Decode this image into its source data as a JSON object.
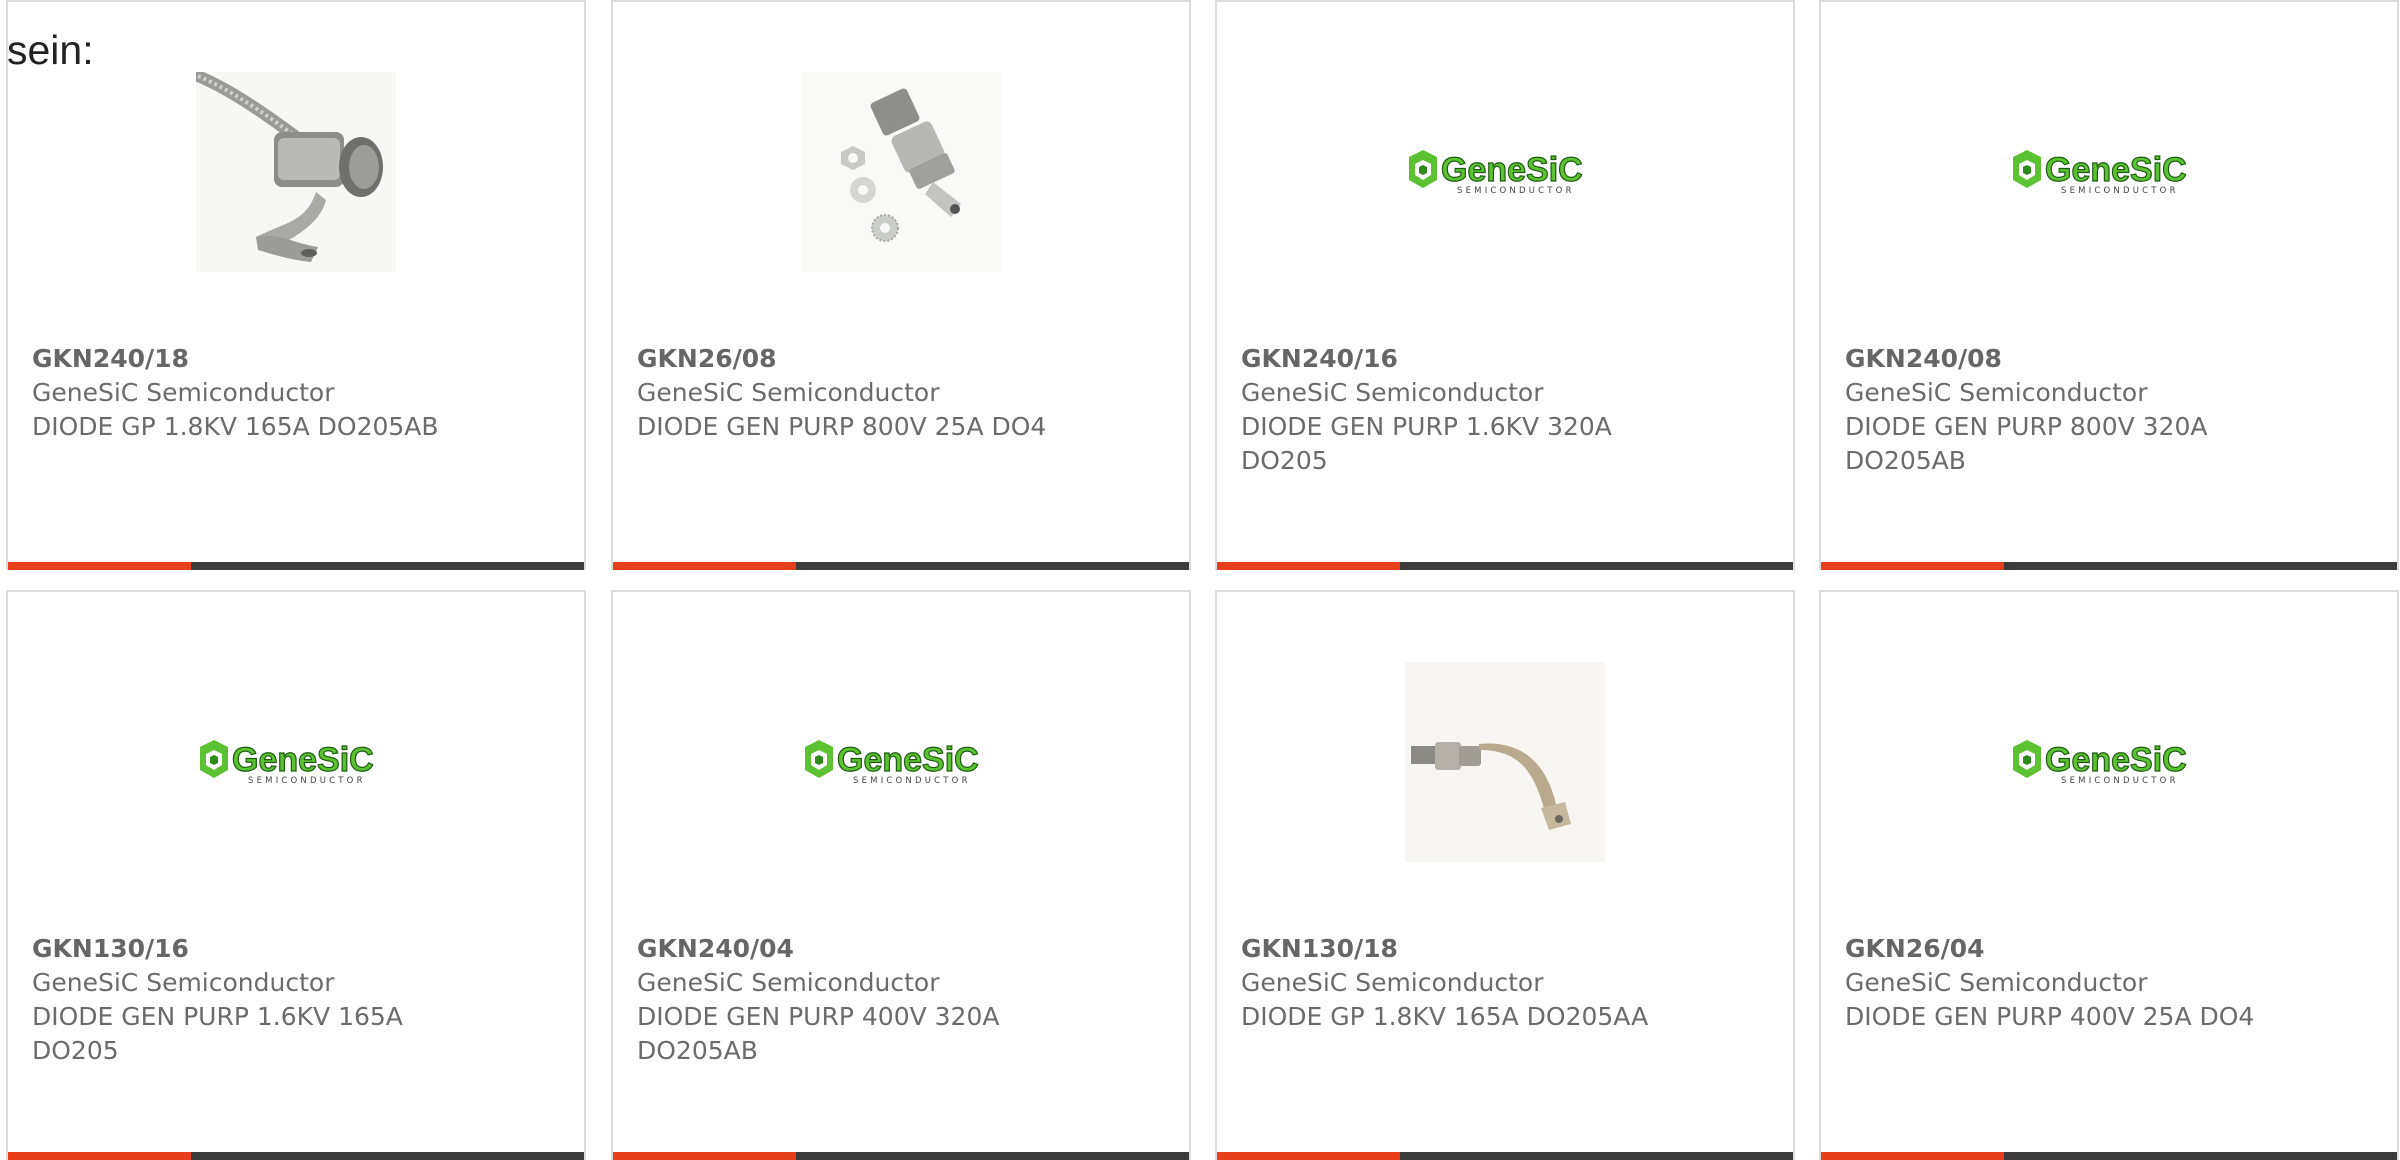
{
  "lead_text": "sein:",
  "colors": {
    "accent": "#e8401c",
    "bar": "#3c3c3c",
    "text": "#6b6b6b",
    "logo_green": "#5cc234",
    "logo_dark": "#2f8a1c"
  },
  "logo": {
    "wordmark": "GeneSiC",
    "tagline": "SEMICONDUCTOR"
  },
  "products": [
    {
      "part": "GKN240/18",
      "manufacturer": "GeneSiC Semiconductor",
      "description": "DIODE GP 1.8KV 165A DO205AB",
      "image": "stud-diode-braided-lead"
    },
    {
      "part": "GKN26/08",
      "manufacturer": "GeneSiC Semiconductor",
      "description": "DIODE GEN PURP 800V 25A DO4",
      "image": "stud-diode-with-hardware"
    },
    {
      "part": "GKN240/16",
      "manufacturer": "GeneSiC Semiconductor",
      "description": "DIODE GEN PURP 1.6KV 320A DO205",
      "image": "genesic-logo"
    },
    {
      "part": "GKN240/08",
      "manufacturer": "GeneSiC Semiconductor",
      "description": "DIODE GEN PURP 800V 320A DO205AB",
      "image": "genesic-logo"
    },
    {
      "part": "GKN130/16",
      "manufacturer": "GeneSiC Semiconductor",
      "description": "DIODE GEN PURP 1.6KV 165A DO205",
      "image": "genesic-logo"
    },
    {
      "part": "GKN240/04",
      "manufacturer": "GeneSiC Semiconductor",
      "description": "DIODE GEN PURP 400V 320A DO205AB",
      "image": "genesic-logo"
    },
    {
      "part": "GKN130/18",
      "manufacturer": "GeneSiC Semiconductor",
      "description": "DIODE GP 1.8KV 165A DO205AA",
      "image": "stud-diode-flex-lead"
    },
    {
      "part": "GKN26/04",
      "manufacturer": "GeneSiC Semiconductor",
      "description": "DIODE GEN PURP 400V 25A DO4",
      "image": "genesic-logo"
    }
  ]
}
